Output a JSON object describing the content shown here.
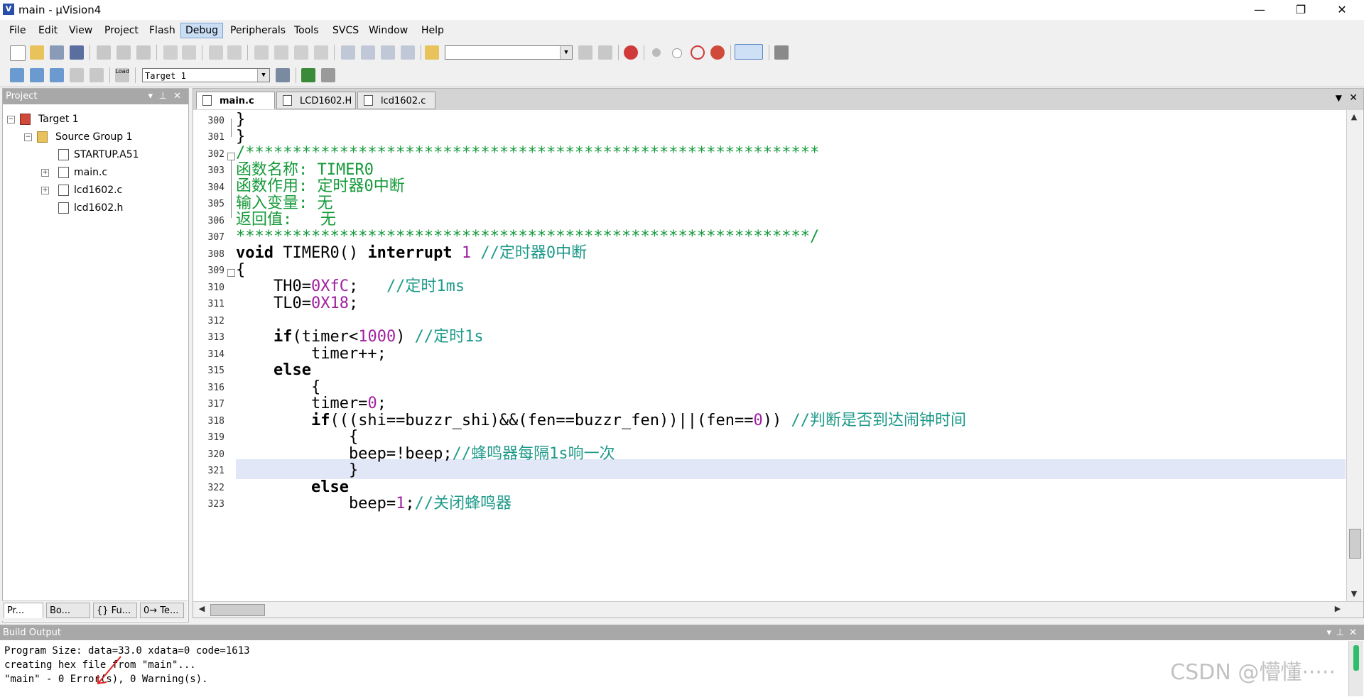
{
  "window": {
    "title": "main - µVision4",
    "app_icon": "uvision-icon",
    "minimize": "—",
    "restore": "❐",
    "close": "✕"
  },
  "menu": [
    {
      "label": "File"
    },
    {
      "label": "Edit"
    },
    {
      "label": "View"
    },
    {
      "label": "Project"
    },
    {
      "label": "Flash"
    },
    {
      "label": "Debug"
    },
    {
      "label": "Peripherals"
    },
    {
      "label": "Tools"
    },
    {
      "label": "SVCS"
    },
    {
      "label": "Window"
    },
    {
      "label": "Help"
    }
  ],
  "toolbar": {
    "find_combo_value": "",
    "target_combo_value": "Target 1",
    "load_label": "Load"
  },
  "project_panel": {
    "title": "Project",
    "tree": {
      "target": "Target 1",
      "group": "Source Group 1",
      "files": [
        "STARTUP.A51",
        "main.c",
        "lcd1602.c",
        "lcd1602.h"
      ]
    },
    "tabs": [
      {
        "label": "Pr..."
      },
      {
        "label": "Bo..."
      },
      {
        "label": "{} Fu..."
      },
      {
        "label": "0→ Te..."
      }
    ]
  },
  "editor": {
    "tabs": [
      {
        "label": "main.c"
      },
      {
        "label": "LCD1602.H"
      },
      {
        "label": "lcd1602.c"
      }
    ],
    "line_numbers": [
      "300",
      "301",
      "302",
      "303",
      "304",
      "305",
      "306",
      "307",
      "308",
      "309",
      "310",
      "311",
      "312",
      "313",
      "314",
      "315",
      "316",
      "317",
      "318",
      "319",
      "320",
      "321",
      "322",
      "323"
    ],
    "lines": {
      "l300": "}",
      "l301": "}",
      "l302": "/*************************************************************",
      "l303": "函数名称: TIMER0",
      "l304": "函数作用: 定时器0中断",
      "l305": "输入变量: 无",
      "l306": "返回值:   无",
      "l307": "*************************************************************/",
      "l308_kw1": "void",
      "l308_a": " TIMER0() ",
      "l308_kw2": "interrupt",
      "l308_num": " 1",
      "l308_cm": " //定时器0中断",
      "l309": "{",
      "l310_a": "    TH0=",
      "l310_num": "0XfC",
      "l310_b": ";",
      "l310_cm": "   //定时1ms",
      "l311_a": "    TL0=",
      "l311_num": "0X18",
      "l311_b": ";",
      "l313_kw": "    if",
      "l313_a": "(timer<",
      "l313_num": "1000",
      "l313_b": ")",
      "l313_cm": " //定时1s",
      "l314": "        timer++;",
      "l315_kw": "    else",
      "l316": "        {",
      "l317_a": "        timer=",
      "l317_num": "0",
      "l317_b": ";",
      "l318_kw": "        if",
      "l318_a": "(((shi==buzzr_shi)&&(fen==buzzr_fen))||(fen==",
      "l318_num": "0",
      "l318_b": "))",
      "l318_cm": " //判断是否到达闹钟时间",
      "l319": "            {",
      "l320_a": "            beep=!beep;",
      "l320_cm": "//蜂鸣器每隔1s响一次",
      "l321": "            }",
      "l322_kw": "        else",
      "l323_a": "            beep=",
      "l323_num": "1",
      "l323_b": ";",
      "l323_cm": "//关闭蜂鸣器"
    }
  },
  "build_output": {
    "title": "Build Output",
    "lines": [
      "Program Size: data=33.0 xdata=0 code=1613",
      "creating hex file from \"main\"...",
      "\"main\" - 0 Error(s), 0 Warning(s)."
    ]
  },
  "watermark": "CSDN @懵懂·····",
  "colors": {
    "keyword": "#000000",
    "comment": "#1f9a8a",
    "header_comment": "#159a3a",
    "number": "#a020a0",
    "current_line": "#e2e7f8",
    "panel_header": "#a8a8a8"
  }
}
